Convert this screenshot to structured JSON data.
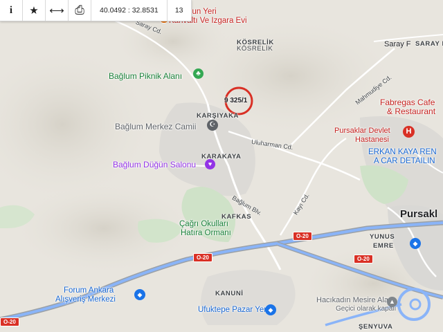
{
  "toolbar": {
    "info_icon": "i",
    "star_icon": "★",
    "measure_icon": "⟷",
    "print_icon": "⎙",
    "coordinates": "40.0492 : 32.8531",
    "zoom_level": "13"
  },
  "map": {
    "top_cafe": "eyno'hun Yeri",
    "top_cafe_sub": "Kahvaltı Ve Izgara Evi",
    "kosrelik_upper": "KÖSRELİK",
    "kosrelik_lower": "KÖSRELİK",
    "saray_fatih": "SARAY FATİH",
    "saray": "Saray F",
    "baglum_piknik": "Bağlum Piknik Alanı",
    "parcel_label": "9 325/1",
    "karsiyaka": "KARŞIYAKA",
    "baglum_merkez_camii": "Bağlum Merkez Camii",
    "fabregas": "Fabregas Cafe",
    "fabregas_sub": "& Restaurant",
    "pursaklar_devlet": "Pursaklar Devlet",
    "pursaklar_devlet_sub": "Hastanesi",
    "erkan_kaya": "ERKAN KAYA REN",
    "erkan_kaya_sub": "A CAR DETAILIN",
    "uluharman_cd": "Uluharman Cd.",
    "mahmudiye_cd": "Mahmudiye Cd.",
    "karakaya": "KARAKAYA",
    "baglum_dugun": "Bağlum Düğün Salonu",
    "baglum_blv": "Bağlum Blv.",
    "kayi_cd": "Kayı Cd.",
    "kafkas": "KAFKAS",
    "pursaklar": "Pursakl",
    "cagri_okullari": "Çağrı Okulları",
    "cagri_okullari_sub": "Hatıra Ormanı",
    "yunus_emre": "YUNUS",
    "yunus_emre_sub": "EMRE",
    "o20_a": "O-20",
    "o20_b": "O-20",
    "o20_c": "O-20",
    "o20_d": "O-20",
    "forum_ankara": "Forum Ankara",
    "forum_ankara_sub": "Alışveriş Merkezi",
    "kanuni": "KANUNİ",
    "ufuktepe": "Ufuktepe Pazar Yeri",
    "hacikadin": "Hacıkadın Mesire Alanı",
    "hacikadin_sub": "Geçici olarak kapalı",
    "senyuva": "ŞENYUVA",
    "saray_cd": "Saray Cd."
  }
}
